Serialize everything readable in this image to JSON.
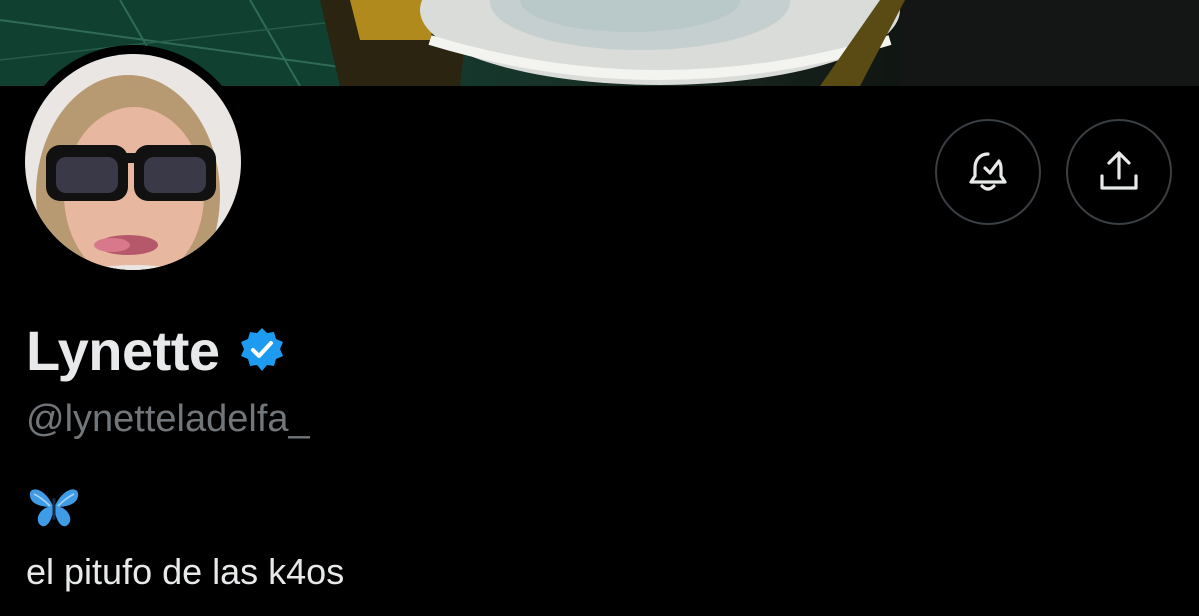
{
  "profile": {
    "display_name": "Lynette",
    "verified": true,
    "handle": "@lynetteladelfa_",
    "bio_emoji_icon": "butterfly-emoji",
    "bio": "el pitufo de las k4os"
  },
  "actions": {
    "notifications_icon": "bell-check-icon",
    "share_icon": "share-upload-icon"
  },
  "colors": {
    "background": "#000000",
    "text_primary": "#e7e9ea",
    "text_secondary": "#71767b",
    "verified_blue": "#1d9bf0",
    "button_border": "#3a3f44"
  }
}
